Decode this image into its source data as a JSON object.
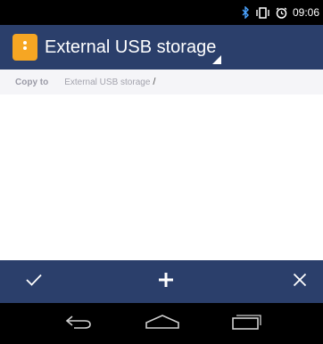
{
  "status_bar": {
    "time": "09:06",
    "icons": [
      "bluetooth-icon",
      "vibrate-icon",
      "alarm-icon"
    ]
  },
  "title_bar": {
    "title": "External USB storage",
    "app_icon": "app-menu-icon",
    "accent_color": "#f6a623",
    "background_color": "#2b3f6b"
  },
  "breadcrumb": {
    "label": "Copy to",
    "path_item": "External USB storage",
    "separator": "/"
  },
  "action_bar": {
    "buttons": [
      "confirm-icon",
      "add-icon",
      "cancel-icon"
    ]
  },
  "nav_bar": {
    "buttons": [
      "back-icon",
      "home-icon",
      "recents-icon"
    ]
  }
}
